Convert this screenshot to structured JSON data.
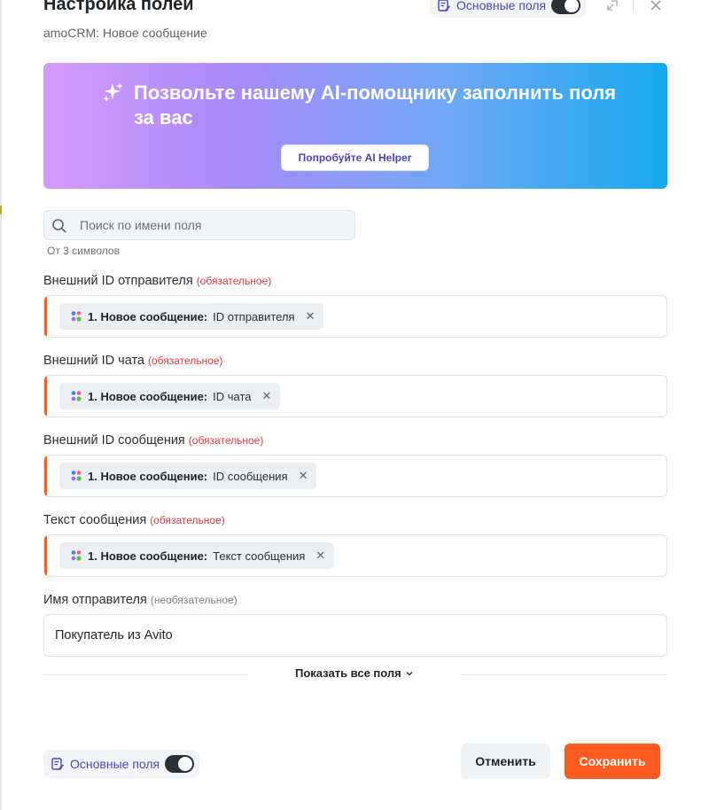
{
  "header": {
    "title": "Настройка полей",
    "subtitle": "amoCRM: Новое сообщение",
    "basic_fields_label": "Основные поля",
    "basic_fields_toggle_on": true
  },
  "ai_banner": {
    "title": "Позвольте нашему AI-помощнику заполнить поля за вас",
    "button_label": "Попробуйте AI Helper"
  },
  "search": {
    "placeholder": "Поиск по имени поля",
    "value": "",
    "hint": "От 3 символов"
  },
  "fields": [
    {
      "label": "Внешний ID отправителя",
      "tag": "(обязательное)",
      "chip_source": "1. Новое сообщение:",
      "chip_value": "ID отправителя",
      "remove": "✕"
    },
    {
      "label": "Внешний ID чата",
      "tag": "(обязательное)",
      "chip_source": "1. Новое сообщение:",
      "chip_value": "ID чата",
      "remove": "✕"
    },
    {
      "label": "Внешний ID сообщения",
      "tag": "(обязательное)",
      "chip_source": "1. Новое сообщение:",
      "chip_value": "ID сообщения",
      "remove": "✕"
    },
    {
      "label": "Текст сообщения",
      "tag": "(обязательное)",
      "chip_source": "1. Новое сообщение:",
      "chip_value": "Текст сообщения",
      "remove": "✕"
    },
    {
      "label": "Имя отправителя",
      "tag": "(необязательное)",
      "value": "Покупатель из Avito"
    }
  ],
  "show_all_label": "Показать все поля",
  "footer": {
    "basic_fields_label": "Основные поля",
    "cancel_label": "Отменить",
    "save_label": "Сохранить"
  },
  "colors": {
    "accent": "#ff5a1f",
    "required": "#e5383b",
    "brand_indigo": "#4b46b6"
  },
  "icons": [
    "list-edit-icon",
    "toggle-switch",
    "collapse-icon",
    "close-icon",
    "sparkle-icon",
    "search-icon",
    "amocrm-app-icon",
    "chevron-down-icon"
  ]
}
